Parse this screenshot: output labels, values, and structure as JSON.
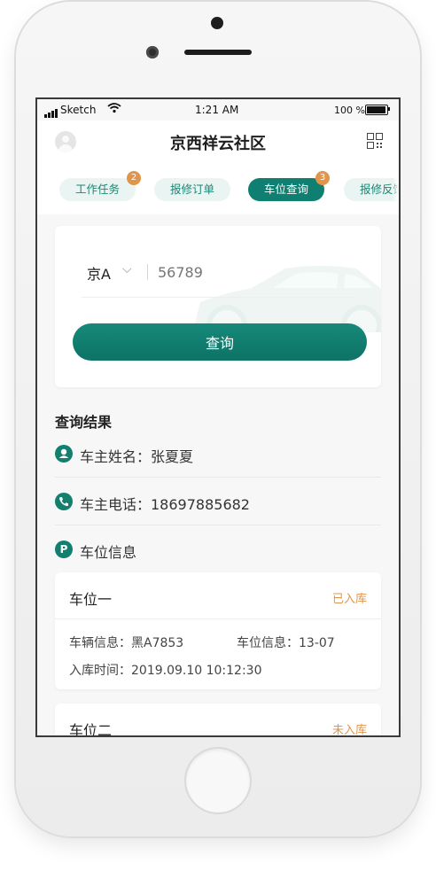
{
  "status_bar": {
    "carrier": "Sketch",
    "time": "1:21 AM",
    "battery": "100 %"
  },
  "header": {
    "title": "京西祥云社区"
  },
  "tabs": [
    {
      "label": "工作任务",
      "badge": "2"
    },
    {
      "label": "报修订单"
    },
    {
      "label": "车位查询",
      "badge": "3",
      "active": true
    },
    {
      "label": "报修反馈"
    }
  ],
  "search": {
    "plate_prefix": "京A",
    "placeholder": "56789",
    "button_label": "查询"
  },
  "results": {
    "title": "查询结果",
    "owner_name": "车主姓名：张夏夏",
    "owner_phone": "车主电话：18697885682",
    "parking_info": "车位信息",
    "slots": [
      {
        "name": "车位一",
        "status": "已入库",
        "vehicle": "车辆信息：黑A7853",
        "slot": "车位信息：13-07",
        "entry_time": "入库时间：2019.09.10 10:12:30"
      },
      {
        "name": "车位二",
        "status": "未入库"
      }
    ]
  },
  "icons": {
    "user": "user-icon",
    "phone": "phone-icon",
    "parking": "parking-icon",
    "qr": "qr-code-icon",
    "dropdown": "chevron-down-icon"
  },
  "colors": {
    "primary": "#0e7f70",
    "badge": "#e0954a",
    "status_orange": "#e0954a"
  }
}
